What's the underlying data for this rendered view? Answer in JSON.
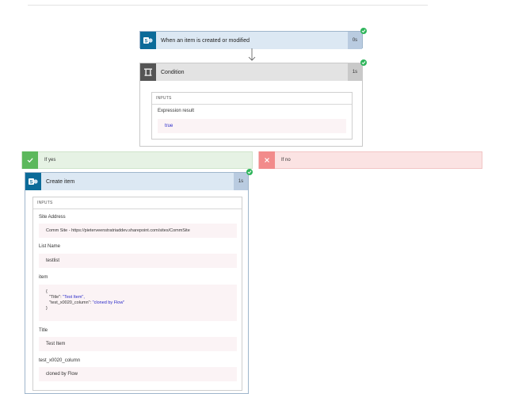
{
  "trigger": {
    "title": "When an item is created or modified",
    "duration": "0s",
    "icon": "sharepoint-icon"
  },
  "condition": {
    "title": "Condition",
    "duration": "1s",
    "icon": "condition-icon",
    "inputs_label": "INPUTS",
    "expression_label": "Expression result",
    "expression_value": "true"
  },
  "branches": {
    "yes": {
      "label": "If yes",
      "icon": "check-icon"
    },
    "no": {
      "label": "If no",
      "icon": "close-icon"
    }
  },
  "create_item": {
    "title": "Create item",
    "duration": "1s",
    "icon": "sharepoint-icon",
    "inputs_label": "INPUTS",
    "site_address_label": "Site Address",
    "site_address_value": "Comm Site - https://pieterveenstratriaddev.sharepoint.com/sites/CommSite",
    "list_name_label": "List Name",
    "list_name_value": "testlist",
    "item_label": "item",
    "item_json": {
      "open": "{",
      "line1_key": "\"Title\": ",
      "line1_val": "\"Test Item\",",
      "line2_key": "\"test_x0020_column\": ",
      "line2_val": "\"cloned by Flow\"",
      "close": "}"
    },
    "title_label": "Title",
    "title_value": "Test Item",
    "column_label": "test_x0020_column",
    "column_value": "cloned by Flow"
  },
  "colors": {
    "card_header": "#dce8f3",
    "condition_header": "#e3e3e3",
    "duration_bg": "#b9cbe0",
    "yes_bg": "#e6f2e4",
    "yes_icon_bg": "#5cb85c",
    "no_bg": "#fbe3e3",
    "no_icon_bg": "#f28b8b",
    "success": "#2fb55b",
    "sharepoint": "#0b6b99",
    "condition_icon_bg": "#555555"
  }
}
